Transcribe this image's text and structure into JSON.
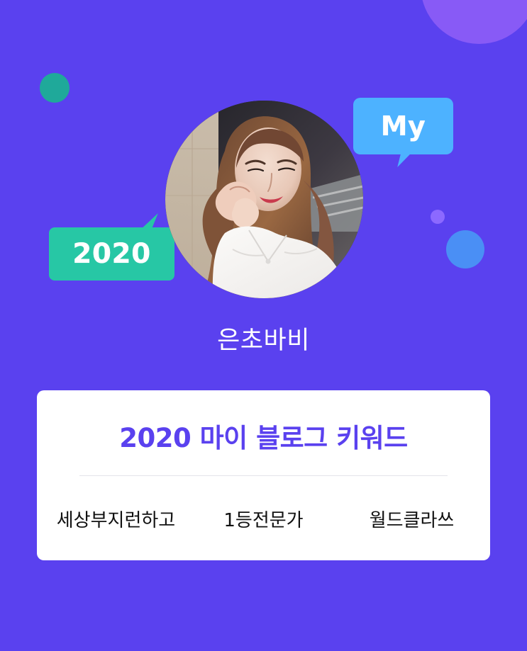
{
  "profile": {
    "badge_year": "2020",
    "badge_my": "My",
    "avatar_icon": "profile-photo",
    "username": "은초바비"
  },
  "keywords_card": {
    "title": "2020 마이 블로그 키워드",
    "items": [
      {
        "label": "세상부지런하고"
      },
      {
        "label": "1등전문가"
      },
      {
        "label": "월드클라쓰"
      }
    ]
  },
  "colors": {
    "background": "#5a41ef",
    "title": "#5a41ef",
    "teal_badge": "#27c7a5",
    "blue_badge": "#4db2ff",
    "card": "#ffffff"
  }
}
